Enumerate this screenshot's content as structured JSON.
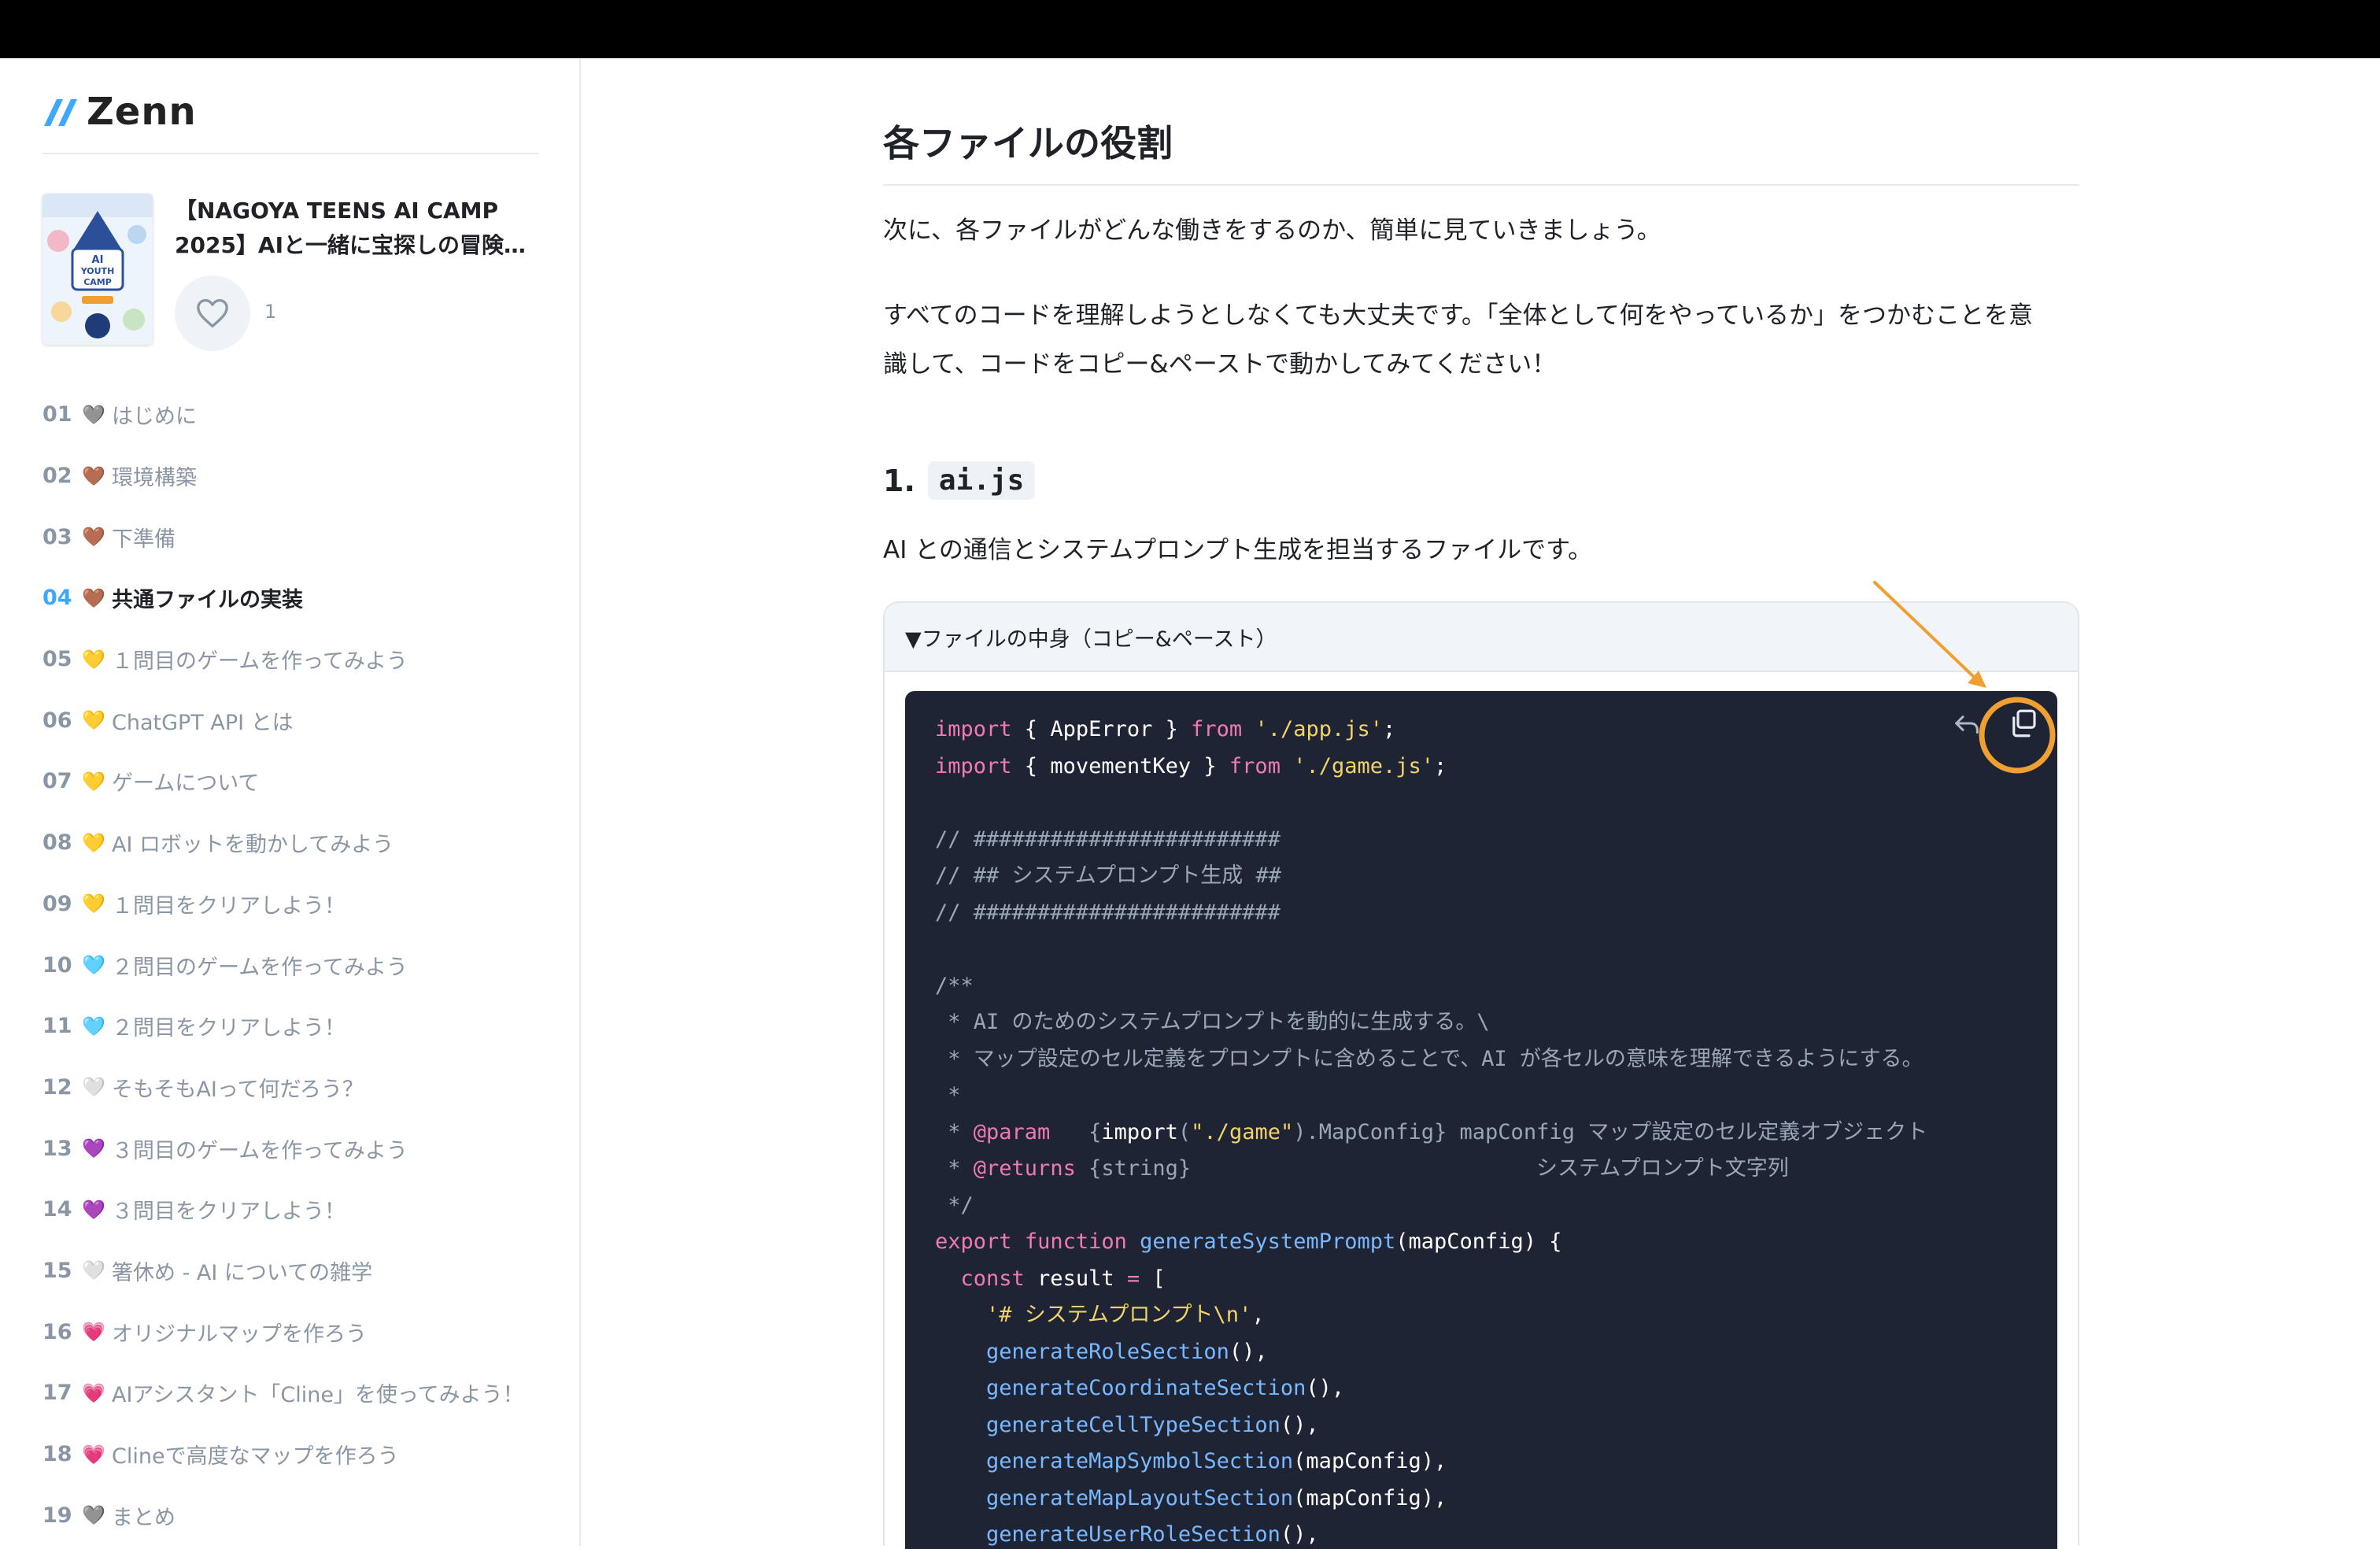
{
  "brand": {
    "name": "Zenn"
  },
  "book": {
    "title_line1": "【NAGOYA TEENS AI CAMP",
    "title_line2": "2025】AIと一緒に宝探しの冒険…",
    "likes": "1",
    "cover_text": "AI YOUTH CAMP"
  },
  "toc": [
    {
      "num": "01",
      "heart": "🩶",
      "label": "はじめに"
    },
    {
      "num": "02",
      "heart": "🤎",
      "label": "環境構築"
    },
    {
      "num": "03",
      "heart": "🤎",
      "label": "下準備"
    },
    {
      "num": "04",
      "heart": "🤎",
      "label": "共通ファイルの実装"
    },
    {
      "num": "05",
      "heart": "💛",
      "label": "１問目のゲームを作ってみよう"
    },
    {
      "num": "06",
      "heart": "💛",
      "label": "ChatGPT API とは"
    },
    {
      "num": "07",
      "heart": "💛",
      "label": "ゲームについて"
    },
    {
      "num": "08",
      "heart": "💛",
      "label": "AI ロボットを動かしてみよう"
    },
    {
      "num": "09",
      "heart": "💛",
      "label": "１問目をクリアしよう！"
    },
    {
      "num": "10",
      "heart": "🩵",
      "label": "２問目のゲームを作ってみよう"
    },
    {
      "num": "11",
      "heart": "🩵",
      "label": "２問目をクリアしよう！"
    },
    {
      "num": "12",
      "heart": "🤍",
      "label": "そもそもAIって何だろう？"
    },
    {
      "num": "13",
      "heart": "💜",
      "label": "３問目のゲームを作ってみよう"
    },
    {
      "num": "14",
      "heart": "💜",
      "label": "３問目をクリアしよう！"
    },
    {
      "num": "15",
      "heart": "🤍",
      "label": "箸休め - AI についての雑学"
    },
    {
      "num": "16",
      "heart": "💗",
      "label": "オリジナルマップを作ろう"
    },
    {
      "num": "17",
      "heart": "💗",
      "label": "AIアシスタント「Cline」を使ってみよう！"
    },
    {
      "num": "18",
      "heart": "💗",
      "label": "Clineで高度なマップを作ろう"
    },
    {
      "num": "19",
      "heart": "🩶",
      "label": "まとめ"
    }
  ],
  "toc_active_index": 3,
  "article": {
    "heading": "各ファイルの役割",
    "para1": "次に、各ファイルがどんな働きをするのか、簡単に見ていきましょう。",
    "para2_line1": "すべてのコードを理解しようとしなくても大丈夫です。「全体として何をやっているか」をつかむことを意",
    "para2_line2": "識して、コードをコピー&ペーストで動かしてみてください！",
    "sub_num": "1.",
    "sub_code": "ai.js",
    "sub_desc": "AI との通信とシステムプロンプト生成を担当するファイルです。",
    "details_summary": "▼ファイルの中身（コピー&ペースト）"
  },
  "code_lines": [
    [
      [
        "kw",
        "import"
      ],
      [
        "pl",
        " { "
      ],
      [
        "pl",
        "AppError"
      ],
      [
        "pl",
        " } "
      ],
      [
        "kw",
        "from"
      ],
      [
        "pl",
        " "
      ],
      [
        "str",
        "'./app.js'"
      ],
      [
        "pl",
        ";"
      ]
    ],
    [
      [
        "kw",
        "import"
      ],
      [
        "pl",
        " { "
      ],
      [
        "pl",
        "movementKey"
      ],
      [
        "pl",
        " } "
      ],
      [
        "kw",
        "from"
      ],
      [
        "pl",
        " "
      ],
      [
        "str",
        "'./game.js'"
      ],
      [
        "pl",
        ";"
      ]
    ],
    [],
    [
      [
        "cm",
        "// ########################"
      ]
    ],
    [
      [
        "cm",
        "// ## システムプロンプト生成 ##"
      ]
    ],
    [
      [
        "cm",
        "// ########################"
      ]
    ],
    [],
    [
      [
        "cm",
        "/**"
      ]
    ],
    [
      [
        "cm",
        " * AI のためのシステムプロンプトを動的に生成する。\\"
      ]
    ],
    [
      [
        "cm",
        " * マップ設定のセル定義をプロンプトに含めることで、AI が各セルの意味を理解できるようにする。"
      ]
    ],
    [
      [
        "cm",
        " *"
      ]
    ],
    [
      [
        "cm",
        " * "
      ],
      [
        "kw",
        "@param"
      ],
      [
        "cm",
        "   {"
      ],
      [
        "pl",
        "import"
      ],
      [
        "cm",
        "("
      ],
      [
        "str",
        "\"./game\""
      ],
      [
        "cm",
        ").MapConfig} mapConfig マップ設定のセル定義オブジェクト"
      ]
    ],
    [
      [
        "cm",
        " * "
      ],
      [
        "kw",
        "@returns"
      ],
      [
        "cm",
        " {string}                           システムプロンプト文字列"
      ]
    ],
    [
      [
        "cm",
        " */"
      ]
    ],
    [
      [
        "kw",
        "export"
      ],
      [
        "pl",
        " "
      ],
      [
        "kw",
        "function"
      ],
      [
        "pl",
        " "
      ],
      [
        "fn",
        "generateSystemPrompt"
      ],
      [
        "pl",
        "(mapConfig) {"
      ]
    ],
    [
      [
        "pl",
        "  "
      ],
      [
        "kw",
        "const"
      ],
      [
        "pl",
        " result "
      ],
      [
        "kw",
        "="
      ],
      [
        "pl",
        " ["
      ]
    ],
    [
      [
        "pl",
        "    "
      ],
      [
        "str",
        "'# システムプロンプト\\n'"
      ],
      [
        "pl",
        ","
      ]
    ],
    [
      [
        "pl",
        "    "
      ],
      [
        "fn",
        "generateRoleSection"
      ],
      [
        "pl",
        "(),"
      ]
    ],
    [
      [
        "pl",
        "    "
      ],
      [
        "fn",
        "generateCoordinateSection"
      ],
      [
        "pl",
        "(),"
      ]
    ],
    [
      [
        "pl",
        "    "
      ],
      [
        "fn",
        "generateCellTypeSection"
      ],
      [
        "pl",
        "(),"
      ]
    ],
    [
      [
        "pl",
        "    "
      ],
      [
        "fn",
        "generateMapSymbolSection"
      ],
      [
        "pl",
        "(mapConfig),"
      ]
    ],
    [
      [
        "pl",
        "    "
      ],
      [
        "fn",
        "generateMapLayoutSection"
      ],
      [
        "pl",
        "(mapConfig),"
      ]
    ],
    [
      [
        "pl",
        "    "
      ],
      [
        "fn",
        "generateUserRoleSection"
      ],
      [
        "pl",
        "(),"
      ]
    ]
  ],
  "colors": {
    "accent": "#3ea8ff",
    "annotation": "#f0a030",
    "code_bg": "#1e2433"
  }
}
